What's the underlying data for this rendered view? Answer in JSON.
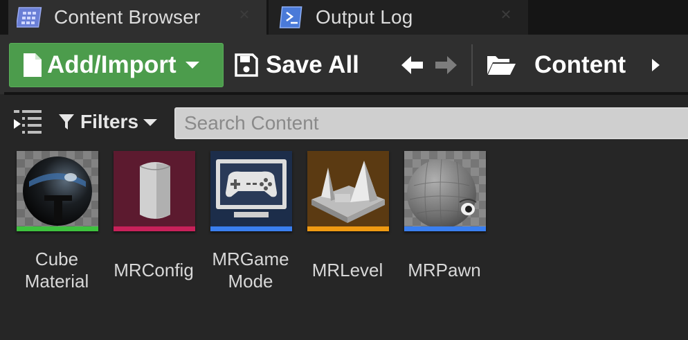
{
  "tabs": [
    {
      "label": "Content Browser",
      "icon": "content-browser-icon",
      "active": true
    },
    {
      "label": "Output Log",
      "icon": "output-log-icon",
      "active": false
    }
  ],
  "toolbar": {
    "add_import_label": "Add/Import",
    "save_all_label": "Save All",
    "breadcrumb_label": "Content"
  },
  "filter_bar": {
    "filters_label": "Filters",
    "search_placeholder": "Search Content"
  },
  "assets": [
    {
      "label_line1": "Cube",
      "label_line2": "Material",
      "type_color": "#3ec23e",
      "icon": "material-sphere-icon"
    },
    {
      "label_line1": "MRConfig",
      "label_line2": "",
      "type_color": "#c8215a",
      "icon": "config-icon"
    },
    {
      "label_line1": "MRGame",
      "label_line2": "Mode",
      "type_color": "#3a7ff0",
      "icon": "game-mode-icon"
    },
    {
      "label_line1": "MRLevel",
      "label_line2": "",
      "type_color": "#f09a12",
      "icon": "level-icon"
    },
    {
      "label_line1": "MRPawn",
      "label_line2": "",
      "type_color": "#3a7ff0",
      "icon": "pawn-icon"
    }
  ],
  "colors": {
    "accent_green": "#4c9c4c",
    "panel_bg": "#262626",
    "toolbar_bg": "#2f2f2f"
  }
}
